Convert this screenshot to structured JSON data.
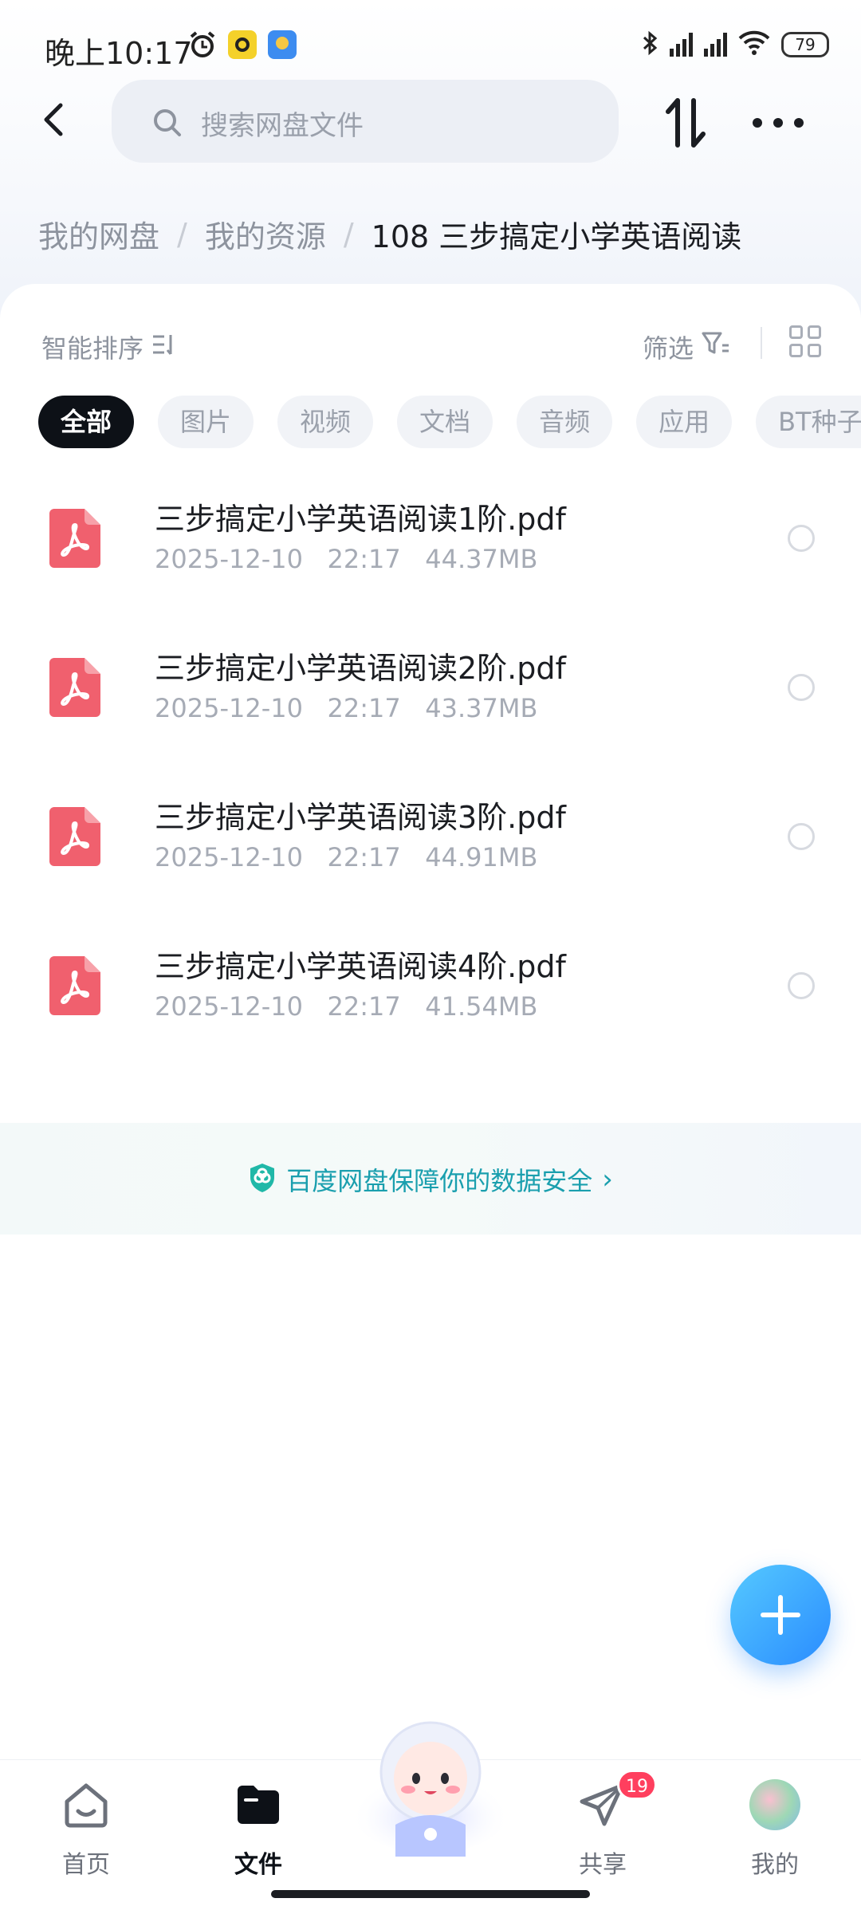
{
  "status_bar": {
    "time": "晚上10:17",
    "battery": "79"
  },
  "header": {
    "search_placeholder": "搜索网盘文件"
  },
  "breadcrumb": {
    "items": [
      "我的网盘",
      "我的资源"
    ],
    "current": "108  三步搞定小学英语阅读"
  },
  "toolbar": {
    "sort_label": "智能排序",
    "filter_label": "筛选"
  },
  "categories": [
    "全部",
    "图片",
    "视频",
    "文档",
    "音频",
    "应用",
    "BT种子"
  ],
  "files": [
    {
      "name": "三步搞定小学英语阅读1阶.pdf",
      "date": "2025-12-10",
      "time": "22:17",
      "size": "44.37MB"
    },
    {
      "name": "三步搞定小学英语阅读2阶.pdf",
      "date": "2025-12-10",
      "time": "22:17",
      "size": "43.37MB"
    },
    {
      "name": "三步搞定小学英语阅读3阶.pdf",
      "date": "2025-12-10",
      "time": "22:17",
      "size": "44.91MB"
    },
    {
      "name": "三步搞定小学英语阅读4阶.pdf",
      "date": "2025-12-10",
      "time": "22:17",
      "size": "41.54MB"
    }
  ],
  "banner": {
    "text": "百度网盘保障你的数据安全"
  },
  "tabbar": {
    "home": "首页",
    "files": "文件",
    "share": "共享",
    "share_badge": "19",
    "mine": "我的"
  },
  "colors": {
    "accent": "#2a8cff",
    "pdf_icon": "#f0606e",
    "banner_text": "#1a9fae",
    "badge": "#ff3f5e"
  }
}
